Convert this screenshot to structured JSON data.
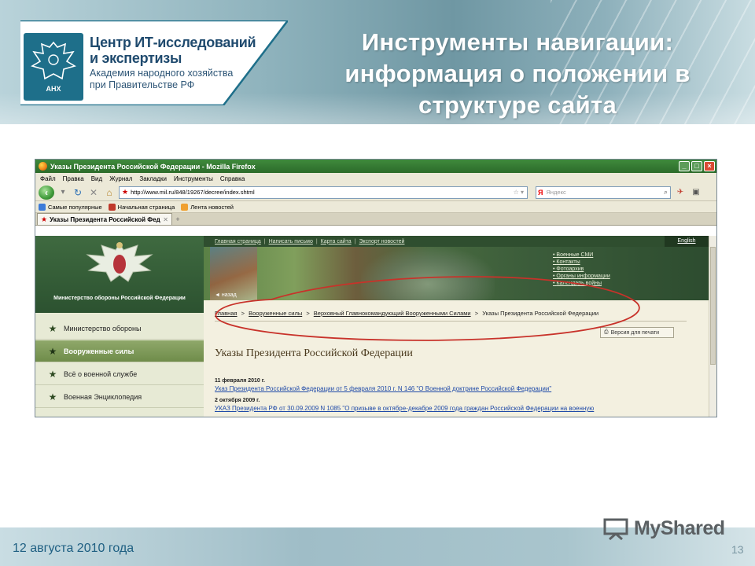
{
  "logo": {
    "line1": "Центр ИТ-исследований",
    "line2": "и экспертизы",
    "line3": "Академия народного хозяйства",
    "line4": "при Правительстве РФ",
    "emblem_text": "АНХ"
  },
  "slide": {
    "title_line1": "Инструменты навигации:",
    "title_line2": "информация о положении в",
    "title_line3": "структуре сайта"
  },
  "browser": {
    "window_title": "Указы Президента Российской Федерации - Mozilla Firefox",
    "window_buttons": [
      "_",
      "□",
      "×"
    ],
    "menu": [
      "Файл",
      "Правка",
      "Вид",
      "Журнал",
      "Закладки",
      "Инструменты",
      "Справка"
    ],
    "url": "http://www.mil.ru/848/19267/decree/index.shtml",
    "search_engine": "Я",
    "search_placeholder": "Яндекс",
    "bookmarks": [
      "Самые популярные",
      "Начальная страница",
      "Лента новостей"
    ],
    "tab_title": "Указы Президента Российской Фед...",
    "tab_add": "+"
  },
  "site": {
    "ministry_name": "Министерство обороны Российской Федерации",
    "top_links": [
      "Главная страница",
      "Написать письмо",
      "Карта сайта",
      "Экспорт новостей"
    ],
    "lang": "English",
    "banner_links": [
      "Военные СМИ",
      "Контакты",
      "Фотоархив",
      "Органы информации",
      "Календарь войны"
    ],
    "back": "◄ назад",
    "menu": [
      {
        "label": "Министерство обороны",
        "active": false
      },
      {
        "label": "Вооруженные силы",
        "active": true
      },
      {
        "label": "Всё о военной службе",
        "active": false
      },
      {
        "label": "Военная Энциклопедия",
        "active": false
      }
    ],
    "breadcrumb": [
      "Главная",
      "Вооруженные силы",
      "Верховный Главнокомандующий Вооруженными Силами",
      "Указы Президента Российской Федерации"
    ],
    "breadcrumb_sep": ">",
    "print_label": "Версия для печати",
    "page_heading": "Указы Президента Российской Федерации",
    "news": [
      {
        "date": "11 февраля 2010 г.",
        "link": "Указ Президента Российской Федерации от 5 февраля 2010 г. N 146 \"О Военной доктрине Российской Федерации\""
      },
      {
        "date": "2 октября 2009 г.",
        "link": "УКАЗ Президента РФ от 30.09.2009 N 1085 \"О призыве в октябре-декабре 2009 года граждан Российской Федерации на военную"
      }
    ]
  },
  "footer": {
    "date": "12 августа 2010 года",
    "page_number": "13"
  },
  "watermark": {
    "text_my": "My",
    "text_shared": "Shared"
  },
  "colors": {
    "title_text": "#ffffff",
    "logo_text": "#1f4a6e",
    "footer_date": "#1e5f82",
    "highlight": "#c8322a",
    "site_green": "#2f4e2f"
  }
}
